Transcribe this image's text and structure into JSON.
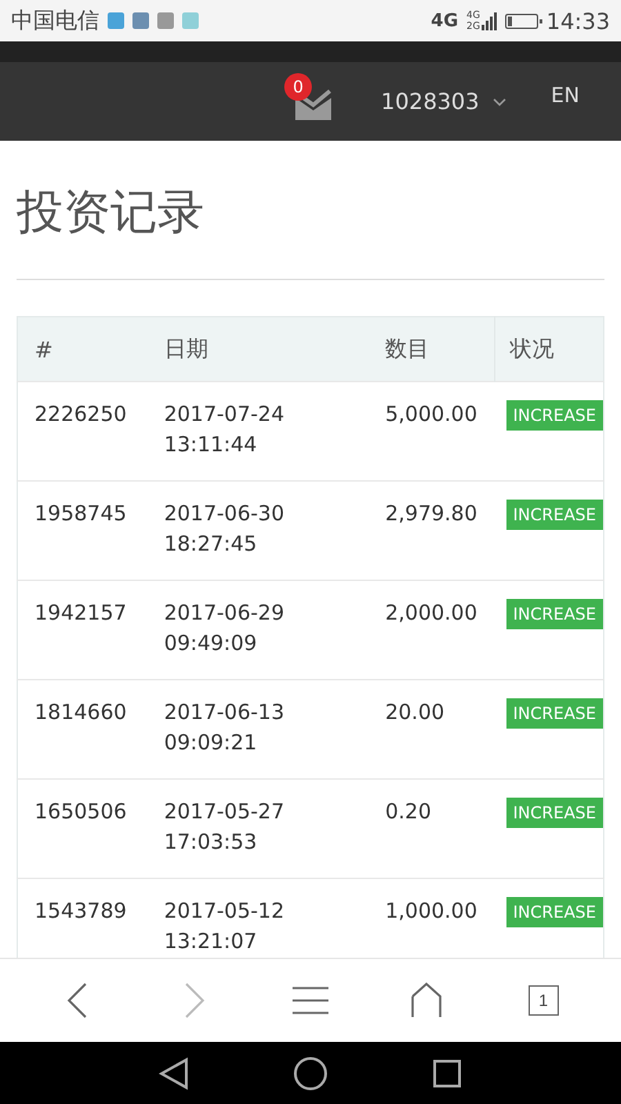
{
  "status_bar": {
    "carrier": "中国电信",
    "network": "4G",
    "signal_labels": [
      "4G",
      "2G"
    ],
    "time": "14:33"
  },
  "header": {
    "unread_count": "0",
    "account": "1028303",
    "language": "EN"
  },
  "page_title": "投资记录",
  "table": {
    "columns": [
      "#",
      "日期",
      "数目",
      "状况"
    ],
    "rows": [
      {
        "id": "2226250",
        "date": "2017-07-24",
        "time": "13:11:44",
        "amount": "5,000.00",
        "status": "INCREASE"
      },
      {
        "id": "1958745",
        "date": "2017-06-30",
        "time": "18:27:45",
        "amount": "2,979.80",
        "status": "INCREASE"
      },
      {
        "id": "1942157",
        "date": "2017-06-29",
        "time": "09:49:09",
        "amount": "2,000.00",
        "status": "INCREASE"
      },
      {
        "id": "1814660",
        "date": "2017-06-13",
        "time": "09:09:21",
        "amount": "20.00",
        "status": "INCREASE"
      },
      {
        "id": "1650506",
        "date": "2017-05-27",
        "time": "17:03:53",
        "amount": "0.20",
        "status": "INCREASE"
      },
      {
        "id": "1543789",
        "date": "2017-05-12",
        "time": "13:21:07",
        "amount": "1,000.00",
        "status": "INCREASE"
      }
    ]
  },
  "browser_bar": {
    "forward_disabled": true,
    "tab_count": "1"
  }
}
